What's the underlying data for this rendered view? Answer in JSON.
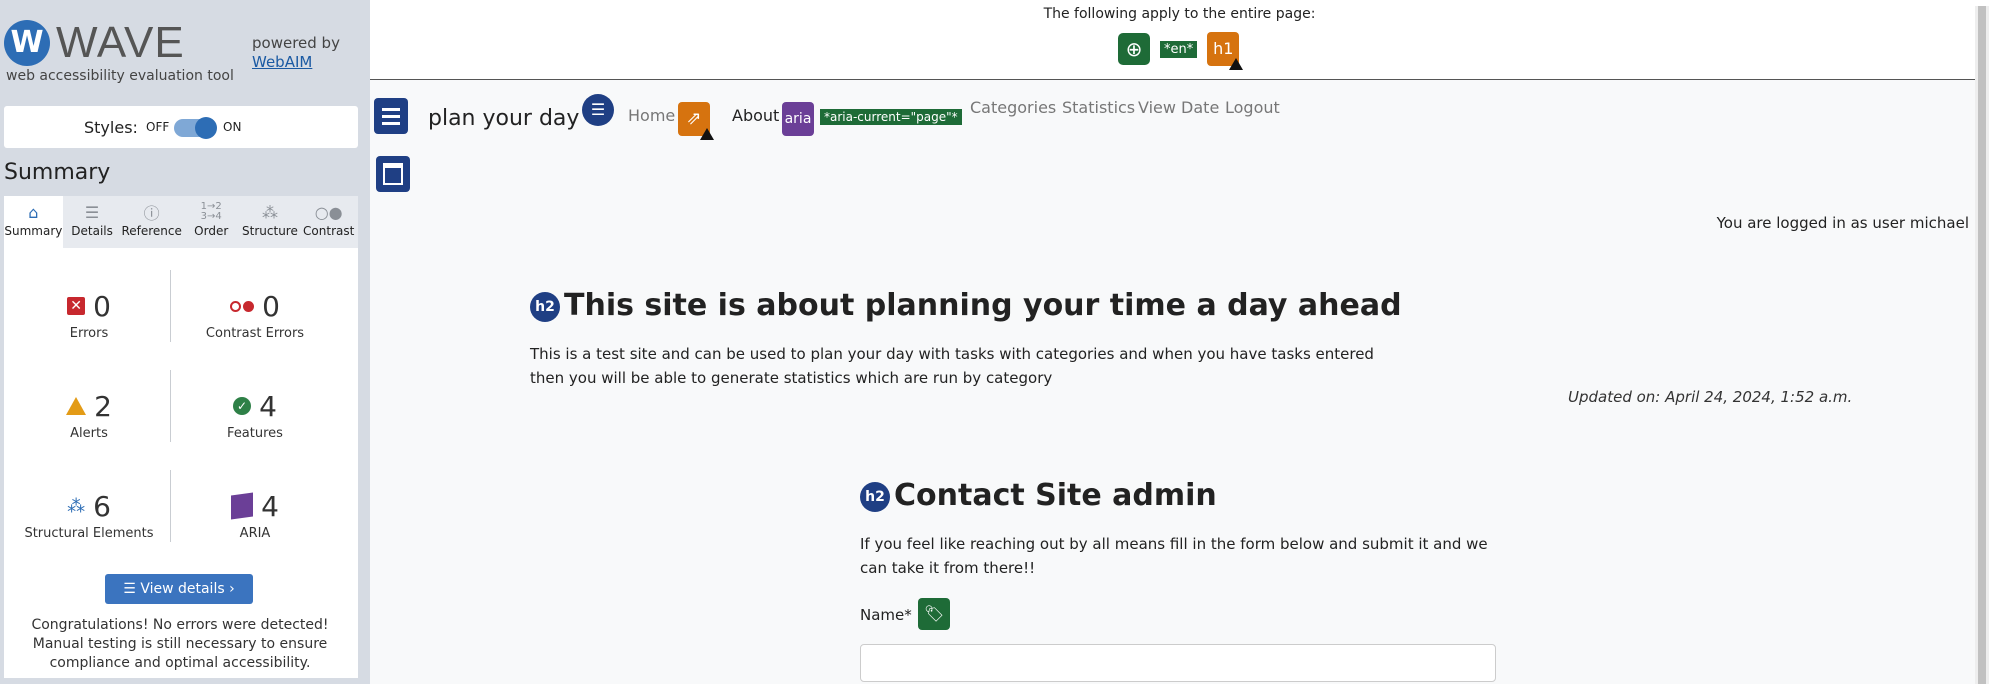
{
  "wave": {
    "logo_letter": "W",
    "title": "WAVE",
    "subtitle": "web accessibility evaluation tool",
    "powered_by": "powered by",
    "webaim_link": "WebAIM",
    "styles_label": "Styles:",
    "styles_off": "OFF",
    "styles_on": "ON",
    "summary_title": "Summary",
    "tabs": [
      {
        "label": "Summary",
        "icon": "home-icon"
      },
      {
        "label": "Details",
        "icon": "list-icon"
      },
      {
        "label": "Reference",
        "icon": "info-icon"
      },
      {
        "label": "Order",
        "icon": "order-icon"
      },
      {
        "label": "Structure",
        "icon": "structure-icon"
      },
      {
        "label": "Contrast",
        "icon": "contrast-icon"
      }
    ],
    "stats": {
      "errors": {
        "count": "0",
        "label": "Errors"
      },
      "contrast_errors": {
        "count": "0",
        "label": "Contrast Errors"
      },
      "alerts": {
        "count": "2",
        "label": "Alerts"
      },
      "features": {
        "count": "4",
        "label": "Features"
      },
      "structural": {
        "count": "6",
        "label": "Structural Elements"
      },
      "aria": {
        "count": "4",
        "label": "ARIA"
      }
    },
    "view_details": "View details ›",
    "congrats": "Congratulations! No errors were detected! Manual testing is still necessary to ensure compliance and optimal accessibility."
  },
  "page": {
    "notice": "The following apply to the entire page:",
    "lang_badge": "*en*",
    "h1_badge": "h1",
    "brand": "plan your day",
    "nav": {
      "home": "Home",
      "about": "About",
      "aria_badge": "aria",
      "aria_current": "*aria-current=\"page\"*",
      "categories": "Categories",
      "statistics": "Statistics",
      "view_date": "View Date",
      "logout": "Logout"
    },
    "logged_in": "You are logged in as user michael",
    "h2_badge": "h2",
    "heading1": "This site is about planning your time a day ahead",
    "para1": "This is a test site and can be used to plan your day with tasks with categories and when you have tasks entered then you will be able to generate statistics which are run by category",
    "updated": "Updated on: April 24, 2024, 1:52 a.m.",
    "heading2": "Contact Site admin",
    "para2": "If you feel like reaching out by all means fill in the form below and submit it and we can take it from there!!",
    "name_label": "Name*",
    "name_value": ""
  },
  "colors": {
    "wave_blue": "#2d6db5",
    "error_red": "#c7282e",
    "alert_orange": "#e39b16",
    "feature_green": "#2e8047",
    "aria_purple": "#6b3f97",
    "structure_navy": "#1f3f84"
  }
}
